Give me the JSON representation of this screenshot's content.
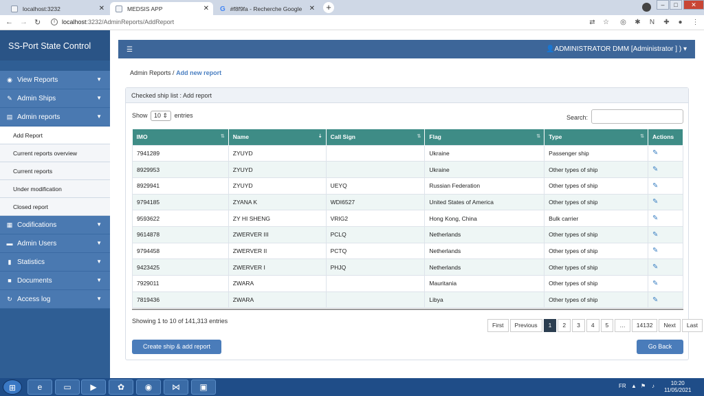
{
  "browser": {
    "tabs": [
      {
        "title": "localhost:3232",
        "active": false
      },
      {
        "title": "MEDSIS APP",
        "active": true
      },
      {
        "title": "#f8f9fa - Recherche Google",
        "active": false
      }
    ],
    "url_host": "localhost",
    "url_path": ":3232/AdminReports/AddReport"
  },
  "sidebar": {
    "brand": "SS-Port State Control",
    "menu": [
      {
        "label": "View Reports",
        "icon": "eye-icon"
      },
      {
        "label": "Admin Ships",
        "icon": "pencil-icon"
      },
      {
        "label": "Admin reports",
        "icon": "file-icon"
      }
    ],
    "submenu": [
      {
        "label": "Add Report"
      },
      {
        "label": "Current reports overview"
      },
      {
        "label": "Current reports"
      },
      {
        "label": "Under modification"
      },
      {
        "label": "Closed report"
      }
    ],
    "menu2": [
      {
        "label": "Codifications",
        "icon": "barcode-icon"
      },
      {
        "label": "Admin Users",
        "icon": "users-icon"
      },
      {
        "label": "Statistics",
        "icon": "bar-chart-icon"
      },
      {
        "label": "Documents",
        "icon": "folder-icon"
      },
      {
        "label": "Access log",
        "icon": "refresh-icon"
      }
    ]
  },
  "header": {
    "user": "ADMINISTRATOR DMM [Administrator ] )"
  },
  "breadcrumb": {
    "parent": "Admin Reports",
    "separator": "/",
    "current": "Add new report"
  },
  "card": {
    "title": "Checked ship list : Add report",
    "show_label": "Show",
    "show_value": "10",
    "entries_label": "entries",
    "search_label": "Search:",
    "columns": [
      "IMO",
      "Name",
      "Call Sign",
      "Flag",
      "Type",
      "Actions"
    ],
    "rows": [
      {
        "imo": "7941289",
        "name": "ZYUYD",
        "callsign": "",
        "flag": "Ukraine",
        "type": "Passenger ship"
      },
      {
        "imo": "8929953",
        "name": "ZYUYD",
        "callsign": "",
        "flag": "Ukraine",
        "type": "Other types of ship"
      },
      {
        "imo": "8929941",
        "name": "ZYUYD",
        "callsign": "UEYQ",
        "flag": "Russian Federation",
        "type": "Other types of ship"
      },
      {
        "imo": "9794185",
        "name": "ZYANA K",
        "callsign": "WDI6527",
        "flag": "United States of America",
        "type": "Other types of ship"
      },
      {
        "imo": "9593622",
        "name": "ZY HI SHENG",
        "callsign": "VRIG2",
        "flag": "Hong Kong, China",
        "type": "Bulk carrier"
      },
      {
        "imo": "9614878",
        "name": "ZWERVER III",
        "callsign": "PCLQ",
        "flag": "Netherlands",
        "type": "Other types of ship"
      },
      {
        "imo": "9794458",
        "name": "ZWERVER II",
        "callsign": "PCTQ",
        "flag": "Netherlands",
        "type": "Other types of ship"
      },
      {
        "imo": "9423425",
        "name": "ZWERVER I",
        "callsign": "PHJQ",
        "flag": "Netherlands",
        "type": "Other types of ship"
      },
      {
        "imo": "7929011",
        "name": "ZWARA",
        "callsign": "",
        "flag": "Mauritania",
        "type": "Other types of ship"
      },
      {
        "imo": "7819436",
        "name": "ZWARA",
        "callsign": "",
        "flag": "Libya",
        "type": "Other types of ship"
      }
    ],
    "info": "Showing 1 to 10 of 141,313 entries",
    "pager": [
      "First",
      "Previous",
      "1",
      "2",
      "3",
      "4",
      "5",
      "…",
      "14132",
      "Next",
      "Last"
    ],
    "pager_active": "1",
    "create_button": "Create ship & add report",
    "back_button": "Go Back"
  },
  "taskbar": {
    "lang": "FR",
    "time": "10:20",
    "date": "11/05/2021"
  }
}
